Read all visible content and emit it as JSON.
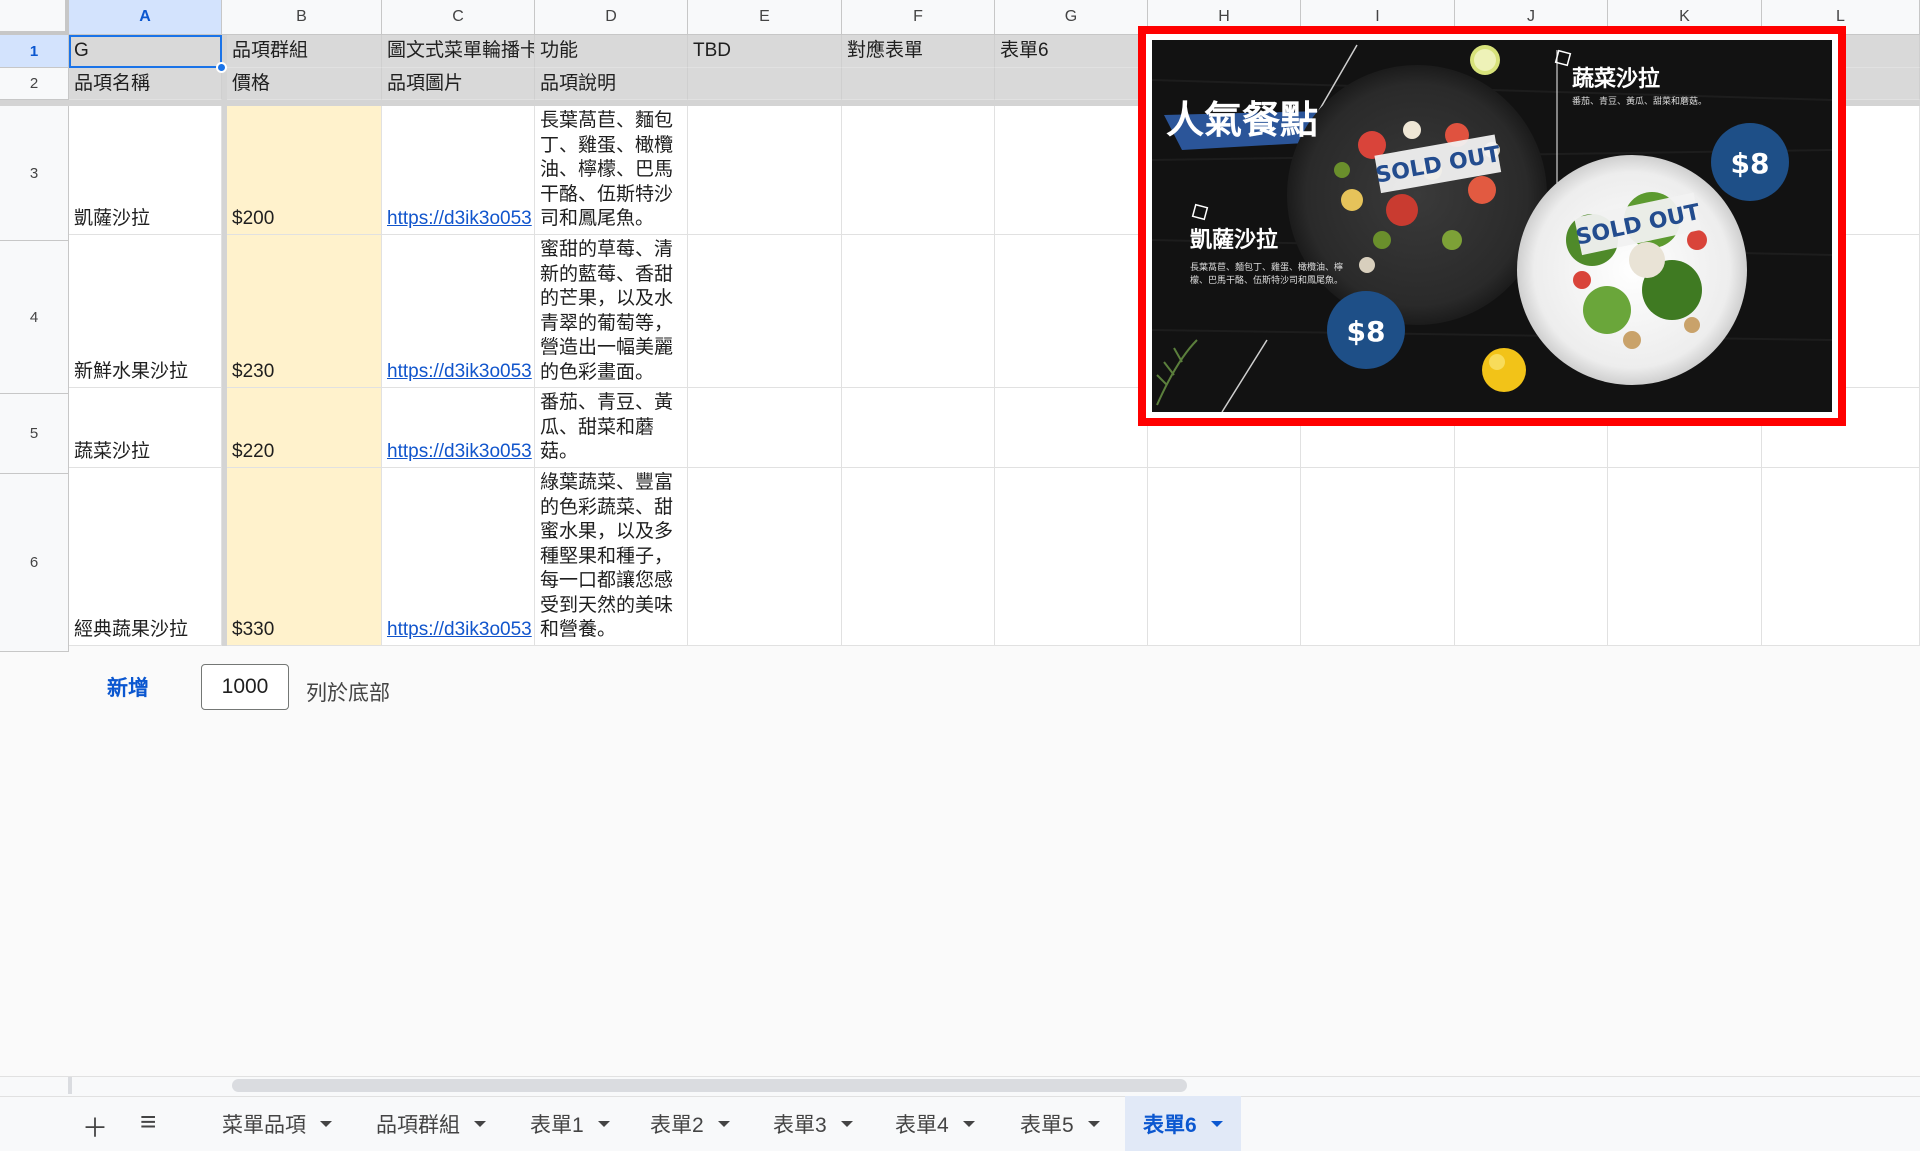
{
  "columns": [
    "A",
    "B",
    "C",
    "D",
    "E",
    "F",
    "G",
    "H",
    "I",
    "J",
    "K",
    "L"
  ],
  "rows": [
    "1",
    "2",
    "3",
    "4",
    "5",
    "6"
  ],
  "header_rows": {
    "row1": [
      "G",
      "品項群組",
      "圖文式菜單輪播卡",
      "功能",
      "TBD",
      "對應表單",
      "表單6"
    ],
    "row2": [
      "品項名稱",
      "價格",
      "品項圖片",
      "品項說明",
      "",
      "",
      ""
    ]
  },
  "data_rows": [
    {
      "name": "凱薩沙拉",
      "price": "$200",
      "image": "https://d3ik3o053",
      "desc": "長葉萵苣、麵包丁、雞蛋、橄欖油、檸檬、巴馬干酪、伍斯特沙司和鳳尾魚。"
    },
    {
      "name": "新鮮水果沙拉",
      "price": "$230",
      "image": "https://d3ik3o053",
      "desc": "蜜甜的草莓、清新的藍莓、香甜的芒果，以及水青翠的葡萄等，營造出一幅美麗的色彩畫面。"
    },
    {
      "name": "蔬菜沙拉",
      "price": "$220",
      "image": "https://d3ik3o053",
      "desc": "番茄、青豆、黃瓜、甜菜和蘑菇。"
    },
    {
      "name": "經典蔬果沙拉",
      "price": "$330",
      "image": "https://d3ik3o053",
      "desc": "綠葉蔬菜、豐富的色彩蔬菜、甜蜜水果，以及多種堅果和種子，每一口都讓您感受到天然的美味和營養。"
    }
  ],
  "poster": {
    "title": "人氣餐點",
    "item1_name": "凱薩沙拉",
    "item1_desc": "長葉萵苣、麵包丁、雞蛋、橄欖油、檸檬、巴馬干酪、伍斯特沙司和鳳尾魚。",
    "item1_price": "$8",
    "item2_name": "蔬菜沙拉",
    "item2_desc": "番茄、青豆、黃瓜、甜菜和蘑菇。",
    "item2_price": "$8",
    "soldout": "SOLD OUT"
  },
  "add_rows": {
    "link": "新增",
    "count": "1000",
    "label": "列於底部"
  },
  "tabs": [
    "菜單品項",
    "品項群組",
    "表單1",
    "表單2",
    "表單3",
    "表單4",
    "表單5",
    "表單6"
  ],
  "active_tab": "表單6",
  "icons": {
    "add": "plus-icon",
    "menu": "hamburger-menu-icon"
  },
  "colors": {
    "selection": "#1a73e8",
    "highlight_column": "#fff2cc",
    "image_border": "#ff0000",
    "link": "#1155cc"
  }
}
